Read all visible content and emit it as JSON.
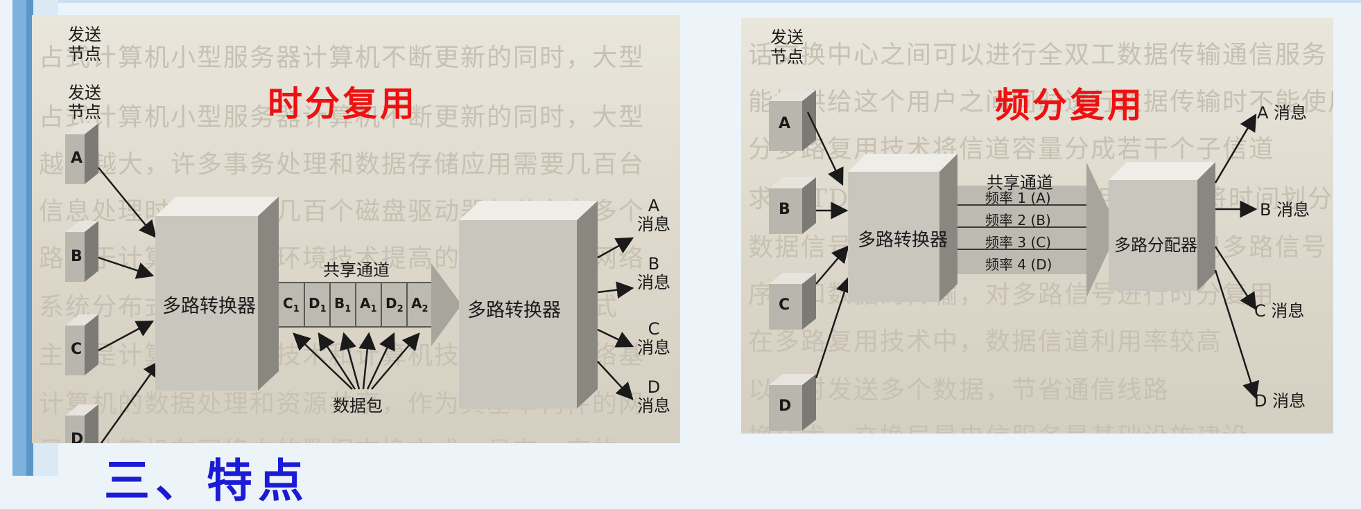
{
  "tdm_panel": {
    "title": "时分复用",
    "send_node_labels": [
      "发送\n节点",
      "发送\n节点"
    ],
    "sources": [
      "A",
      "B",
      "C",
      "D"
    ],
    "mux_label": "多路转换器",
    "demux_label": "多路转换器",
    "channel_label": "共享通道",
    "packets": [
      {
        "letter": "C",
        "sub": "1"
      },
      {
        "letter": "D",
        "sub": "1"
      },
      {
        "letter": "B",
        "sub": "1"
      },
      {
        "letter": "A",
        "sub": "1"
      },
      {
        "letter": "D",
        "sub": "2"
      },
      {
        "letter": "A",
        "sub": "2"
      }
    ],
    "packet_caption": "数据包",
    "messages": [
      "A\n消息",
      "B\n消息",
      "C\n消息",
      "D\n消息"
    ]
  },
  "fdm_panel": {
    "title": "频分复用",
    "send_node_label": "发送\n节点",
    "sources": [
      "A",
      "B",
      "C",
      "D"
    ],
    "mux_label": "多路转换器",
    "demux_label": "多路分配器",
    "channel_label": "共享通道",
    "frequencies": [
      "频率 1 (A)",
      "频率 2 (B)",
      "频率 3 (C)",
      "频率 4 (D)"
    ],
    "messages": [
      "A 消息",
      "B 消息",
      "C 消息",
      "D 消息"
    ]
  },
  "section_title": "三、特点",
  "colors": {
    "title_red": "#ee1111",
    "section_blue": "#1b1bd6",
    "side_bar": "#7fb1dd"
  }
}
